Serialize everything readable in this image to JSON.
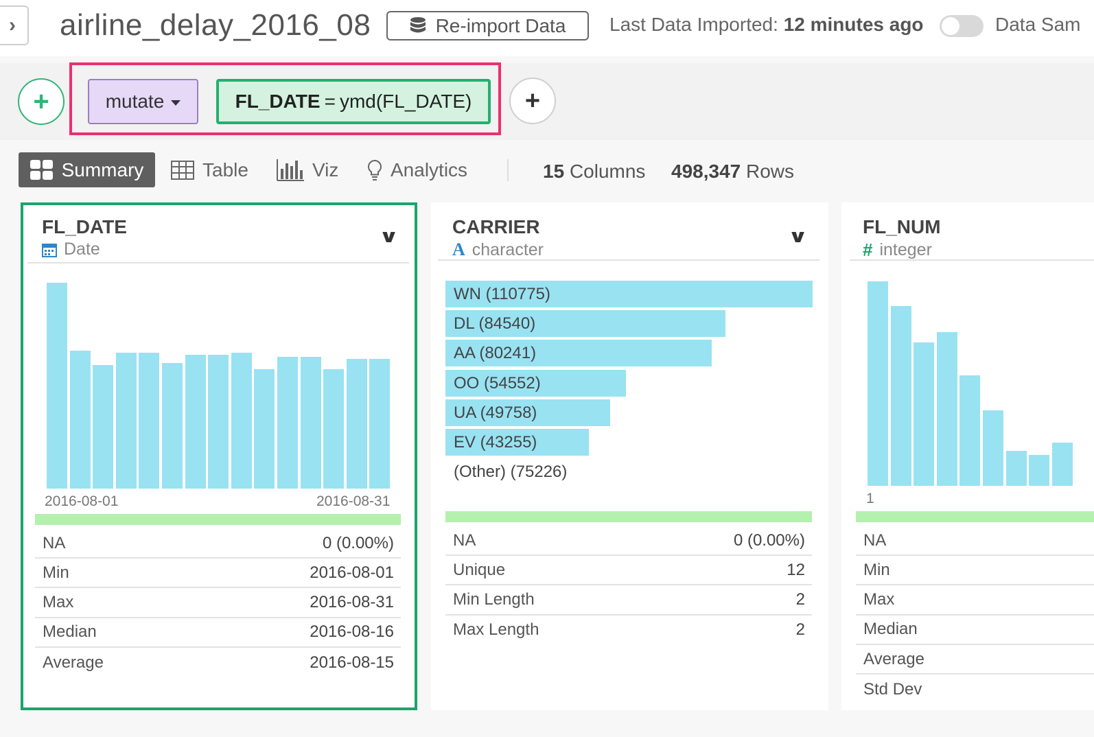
{
  "header": {
    "title": "airline_delay_2016_08",
    "reimport_label": "Re-import Data",
    "last_imported_label": "Last Data Imported:",
    "last_imported_value": "12 minutes ago",
    "data_sample_label": "Data Sam",
    "data_sample_toggle": "off"
  },
  "pipeline": {
    "add_icon": "plus-icon",
    "step_command": "mutate",
    "expr_column": "FL_DATE",
    "expr_operator": "=",
    "expr_value": "ymd(FL_DATE)"
  },
  "tabs": {
    "summary": "Summary",
    "table": "Table",
    "viz": "Viz",
    "analytics": "Analytics",
    "columns_count": "15",
    "columns_label": "Columns",
    "rows_count": "498,347",
    "rows_label": "Rows"
  },
  "columns": [
    {
      "name": "FL_DATE",
      "type": "Date",
      "type_icon": "calendar-icon",
      "axis_min": "2016-08-01",
      "axis_max": "2016-08-31",
      "stats": [
        {
          "k": "NA",
          "v": "0 (0.00%)"
        },
        {
          "k": "Min",
          "v": "2016-08-01"
        },
        {
          "k": "Max",
          "v": "2016-08-31"
        },
        {
          "k": "Median",
          "v": "2016-08-16"
        },
        {
          "k": "Average",
          "v": "2016-08-15"
        }
      ]
    },
    {
      "name": "CARRIER",
      "type": "character",
      "type_icon": "letter-a-icon",
      "stats": [
        {
          "k": "NA",
          "v": "0 (0.00%)"
        },
        {
          "k": "Unique",
          "v": "12"
        },
        {
          "k": "Min Length",
          "v": "2"
        },
        {
          "k": "Max Length",
          "v": "2"
        }
      ]
    },
    {
      "name": "FL_NUM",
      "type": "integer",
      "type_icon": "hash-icon",
      "axis_min": "1",
      "stats": [
        {
          "k": "NA",
          "v": ""
        },
        {
          "k": "Min",
          "v": ""
        },
        {
          "k": "Max",
          "v": ""
        },
        {
          "k": "Median",
          "v": ""
        },
        {
          "k": "Average",
          "v": ""
        },
        {
          "k": "Std Dev",
          "v": ""
        }
      ]
    }
  ],
  "chart_data": [
    {
      "type": "bar",
      "column": "FL_DATE",
      "series_relative_height": [
        1.0,
        0.67,
        0.6,
        0.66,
        0.66,
        0.61,
        0.65,
        0.65,
        0.66,
        0.58,
        0.64,
        0.64,
        0.58,
        0.63,
        0.63
      ],
      "xlabels": [
        "2016-08-01",
        "2016-08-31"
      ]
    },
    {
      "type": "bar",
      "column": "CARRIER",
      "categories": [
        "WN",
        "DL",
        "AA",
        "OO",
        "UA",
        "EV"
      ],
      "values": [
        110775,
        84540,
        80241,
        54552,
        49758,
        43255
      ],
      "other_label": "(Other)",
      "other_value": 75226
    },
    {
      "type": "bar",
      "column": "FL_NUM",
      "series_relative_height": [
        1.0,
        0.88,
        0.7,
        0.75,
        0.54,
        0.37,
        0.17,
        0.15,
        0.21
      ],
      "xlabels": [
        "1"
      ]
    }
  ],
  "colors": {
    "accent_green": "#1aa56b",
    "highlight_pink": "#ec2f6e",
    "bar_blue": "#98e2f2",
    "band_green": "#b4f0ae",
    "mutate_purple": "#e6d9f7"
  }
}
